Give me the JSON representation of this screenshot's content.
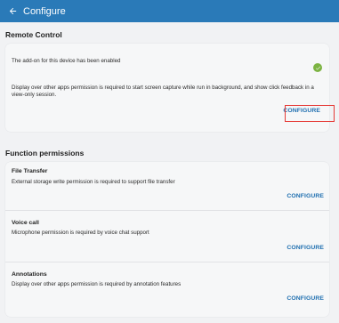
{
  "appbar": {
    "title": "Configure"
  },
  "remote_control": {
    "heading": "Remote Control",
    "enabled_text": "The add-on for this device has been enabled",
    "permission_text": "Display over other apps permission is required to start screen capture while run in background, and show click feedback in a view-only session.",
    "configure_label": "CONFIGURE"
  },
  "function_permissions": {
    "heading": "Function permissions",
    "items": [
      {
        "title": "File Transfer",
        "desc": "External storage write permission is required to support file transfer",
        "configure_label": "CONFIGURE"
      },
      {
        "title": "Voice call",
        "desc": "Microphone permission is required by voice chat support",
        "configure_label": "CONFIGURE"
      },
      {
        "title": "Annotations",
        "desc": "Display over other apps permission is required by annotation features",
        "configure_label": "CONFIGURE"
      }
    ]
  },
  "colors": {
    "appbar": "#2a7ab8",
    "accent": "#1f6fb0",
    "success": "#7cb342",
    "highlight": "#e53935"
  },
  "icons": {
    "back": "arrow-left-icon",
    "status": "check-circle-icon"
  }
}
